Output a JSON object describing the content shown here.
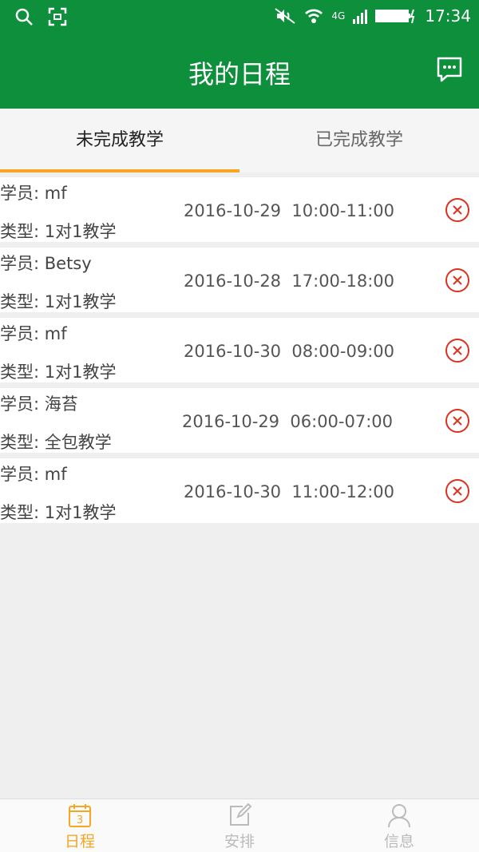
{
  "status_bar": {
    "time": "17:34",
    "network": "4G",
    "left_icons": [
      "search-icon",
      "scan-icon"
    ],
    "right_icons": [
      "mute-icon",
      "wifi-icon",
      "signal-icon",
      "battery-icon"
    ]
  },
  "header": {
    "title": "我的日程",
    "message_icon": "message-icon",
    "bg_color": "#0d8f3c"
  },
  "tabs": [
    {
      "label": "未完成教学",
      "active": true
    },
    {
      "label": "已完成教学",
      "active": false
    }
  ],
  "accent_color": "#f5a623",
  "schedule": [
    {
      "student": "学员: mf",
      "type": "类型: 1对1教学",
      "datetime": "2016-10-29  10:00-11:00"
    },
    {
      "student": "学员: Betsy",
      "type": "类型: 1对1教学",
      "datetime": "2016-10-28  17:00-18:00"
    },
    {
      "student": "学员: mf",
      "type": "类型: 1对1教学",
      "datetime": "2016-10-30  08:00-09:00"
    },
    {
      "student": "学员: 海苔",
      "type": "类型: 全包教学",
      "datetime": "2016-10-29  06:00-07:00"
    },
    {
      "student": "学员: mf",
      "type": "类型: 1对1教学",
      "datetime": "2016-10-30  11:00-12:00"
    }
  ],
  "bottom_nav": [
    {
      "label": "日程",
      "icon": "calendar-icon",
      "badge": "3",
      "active": true
    },
    {
      "label": "安排",
      "icon": "edit-icon",
      "active": false
    },
    {
      "label": "信息",
      "icon": "user-icon",
      "active": false
    }
  ]
}
